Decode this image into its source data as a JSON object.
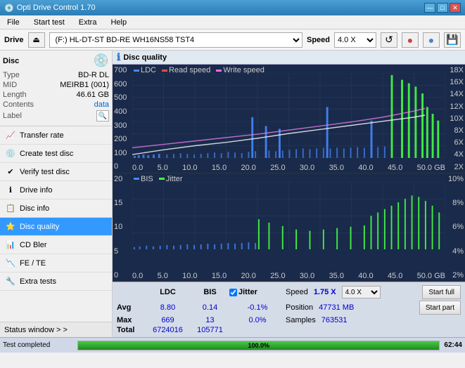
{
  "app": {
    "title": "Opti Drive Control 1.70",
    "icon": "💿"
  },
  "titlebar": {
    "minimize": "—",
    "maximize": "□",
    "close": "✕"
  },
  "menu": {
    "items": [
      "File",
      "Start test",
      "Extra",
      "Help"
    ]
  },
  "drive": {
    "label": "Drive",
    "device": "(F:)  HL-DT-ST BD-RE  WH16NS58 TST4",
    "speed_label": "Speed",
    "speed_value": "4.0 X"
  },
  "disc": {
    "title": "Disc",
    "type_label": "Type",
    "type_value": "BD-R DL",
    "mid_label": "MID",
    "mid_value": "MEIRB1 (001)",
    "length_label": "Length",
    "length_value": "46.61 GB",
    "contents_label": "Contents",
    "contents_value": "data",
    "label_label": "Label"
  },
  "sidebar": {
    "items": [
      {
        "id": "transfer-rate",
        "label": "Transfer rate",
        "icon": "📈"
      },
      {
        "id": "create-test-disc",
        "label": "Create test disc",
        "icon": "💿"
      },
      {
        "id": "verify-test-disc",
        "label": "Verify test disc",
        "icon": "✔"
      },
      {
        "id": "drive-info",
        "label": "Drive info",
        "icon": "ℹ"
      },
      {
        "id": "disc-info",
        "label": "Disc info",
        "icon": "📋"
      },
      {
        "id": "disc-quality",
        "label": "Disc quality",
        "icon": "⭐",
        "active": true
      },
      {
        "id": "cd-bler",
        "label": "CD Bler",
        "icon": "📊"
      },
      {
        "id": "fe-te",
        "label": "FE / TE",
        "icon": "📉"
      },
      {
        "id": "extra-tests",
        "label": "Extra tests",
        "icon": "🔧"
      }
    ],
    "status_window": "Status window > >"
  },
  "disc_quality": {
    "title": "Disc quality",
    "chart1": {
      "legend": {
        "ldc": "LDC",
        "read_speed": "Read speed",
        "write_speed": "Write speed"
      },
      "y_axis": [
        "0",
        "100",
        "200",
        "300",
        "400",
        "500",
        "600",
        "700"
      ],
      "y_axis_right": [
        "2X",
        "4X",
        "6X",
        "8X",
        "10X",
        "12X",
        "14X",
        "16X",
        "18X"
      ],
      "x_axis": [
        "0.0",
        "5.0",
        "10.0",
        "15.0",
        "20.0",
        "25.0",
        "30.0",
        "35.0",
        "40.0",
        "45.0",
        "50.0 GB"
      ]
    },
    "chart2": {
      "legend": {
        "bis": "BIS",
        "jitter": "Jitter"
      },
      "y_axis": [
        "0",
        "5",
        "10",
        "15",
        "20"
      ],
      "y_axis_right": [
        "2%",
        "4%",
        "6%",
        "8%",
        "10%"
      ],
      "x_axis": [
        "0.0",
        "5.0",
        "10.0",
        "15.0",
        "20.0",
        "25.0",
        "30.0",
        "35.0",
        "40.0",
        "45.0",
        "50.0 GB"
      ]
    },
    "stats": {
      "headers": [
        "",
        "LDC",
        "BIS",
        "",
        "Jitter",
        "Speed",
        "",
        ""
      ],
      "avg_label": "Avg",
      "avg_ldc": "8.80",
      "avg_bis": "0.14",
      "avg_jitter": "-0.1%",
      "max_label": "Max",
      "max_ldc": "669",
      "max_bis": "13",
      "max_jitter": "0.0%",
      "total_label": "Total",
      "total_ldc": "6724016",
      "total_bis": "105771",
      "jitter_checked": true,
      "speed_label": "Speed",
      "speed_value": "1.75 X",
      "speed_max": "4.0 X",
      "position_label": "Position",
      "position_value": "47731 MB",
      "samples_label": "Samples",
      "samples_value": "763531",
      "btn_start_full": "Start full",
      "btn_start_part": "Start part"
    }
  },
  "bottom": {
    "status": "Test completed",
    "progress": 100,
    "progress_text": "100.0%",
    "time": "62:44"
  }
}
